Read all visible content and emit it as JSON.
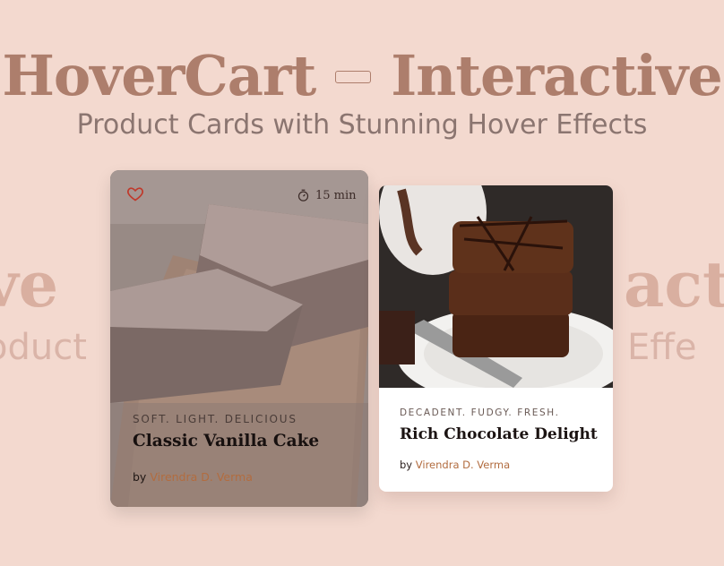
{
  "header": {
    "title_left": "HoverCart",
    "title_right": "Interactive",
    "subtitle": "Product Cards with Stunning Hover Effects"
  },
  "background_echo": {
    "left_word": "ve",
    "left_sub": "oduct",
    "right_word": "act",
    "right_sub": "Effe"
  },
  "cards": [
    {
      "tags": "SOFT. LIGHT. DELICIOUS",
      "name": "Classic Vanilla Cake",
      "by": "by",
      "author": "Virendra D. Verma",
      "time": "15 min",
      "icons": [
        "heart-icon",
        "timer-icon"
      ]
    },
    {
      "tags": "DECADENT. FUDGY. FRESH.",
      "name": "Rich Chocolate Delight",
      "by": "by",
      "author": "Virendra D. Verma"
    }
  ],
  "colors": {
    "background": "#f3d9cf",
    "title": "#ad7e6c",
    "author": "#b26c3f",
    "heart": "#c0392b"
  }
}
